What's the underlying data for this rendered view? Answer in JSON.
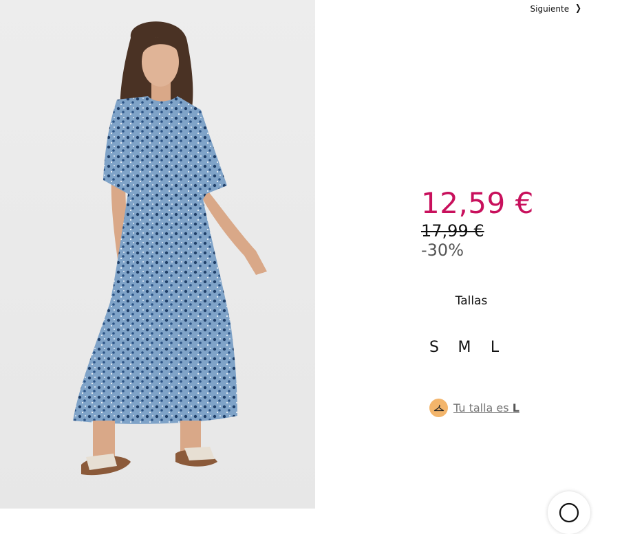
{
  "navigation": {
    "next_label": "Siguiente"
  },
  "product": {
    "image_alt_icon": "dress-model-photo",
    "price_current": "12,59 €",
    "price_original": "17,99 €",
    "discount": "-30%",
    "colors": {
      "sale_price": "#c8105c",
      "size_badge": "#f3b56b"
    }
  },
  "sizes": {
    "title": "Tallas",
    "options": [
      "S",
      "M",
      "L"
    ]
  },
  "size_recommendation": {
    "prefix": "Tu talla es ",
    "size": "L"
  },
  "icons": {
    "next": "chevron-right-icon",
    "hanger": "hanger-icon",
    "chat": "chat-icon"
  }
}
